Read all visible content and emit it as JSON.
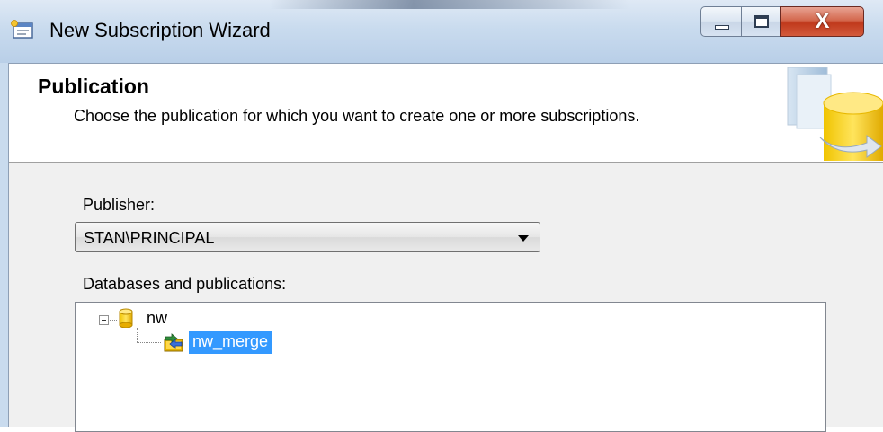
{
  "window": {
    "title": "New Subscription Wizard",
    "controls": {
      "minimize": "minimize",
      "maximize": "maximize",
      "close_glyph": "X"
    }
  },
  "header": {
    "title": "Publication",
    "subtitle": "Choose the publication for which you want to create one or more subscriptions."
  },
  "publisher": {
    "label": "Publisher:",
    "selected": "STAN\\PRINCIPAL"
  },
  "tree": {
    "label": "Databases and publications:",
    "database": "nw",
    "publication": "nw_merge"
  },
  "icons": {
    "app": "wizard-window-icon",
    "header": "database-publication-art",
    "database": "database-cylinder-icon",
    "publication": "merge-publication-icon"
  },
  "colors": {
    "selection": "#3399ff",
    "close_button": "#c0391c",
    "titlebar": "#c9dbee"
  }
}
